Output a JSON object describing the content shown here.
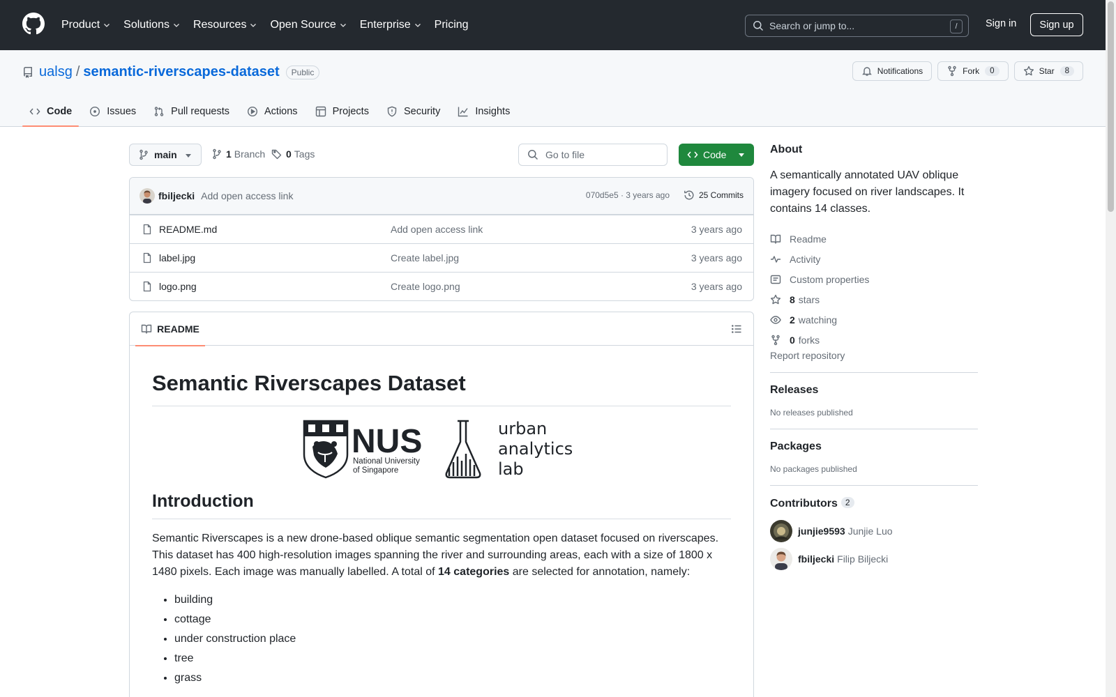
{
  "header": {
    "nav": [
      {
        "label": "Product",
        "caret": true
      },
      {
        "label": "Solutions",
        "caret": true
      },
      {
        "label": "Resources",
        "caret": true
      },
      {
        "label": "Open Source",
        "caret": true
      },
      {
        "label": "Enterprise",
        "caret": true
      },
      {
        "label": "Pricing",
        "caret": false
      }
    ],
    "search_placeholder": "Search or jump to...",
    "search_key": "/",
    "signin": "Sign in",
    "signup": "Sign up"
  },
  "repo": {
    "owner": "ualsg",
    "separator": "/",
    "name": "semantic-riverscapes-dataset",
    "visibility": "Public",
    "notifications": "Notifications",
    "fork_label": "Fork",
    "fork_count": "0",
    "star_label": "Star",
    "star_count": "8",
    "tabs": [
      {
        "label": "Code",
        "icon": "code-icon",
        "selected": true
      },
      {
        "label": "Issues",
        "icon": "issue-icon",
        "selected": false
      },
      {
        "label": "Pull requests",
        "icon": "pull-request-icon",
        "selected": false
      },
      {
        "label": "Actions",
        "icon": "play-icon",
        "selected": false
      },
      {
        "label": "Projects",
        "icon": "table-icon",
        "selected": false
      },
      {
        "label": "Security",
        "icon": "shield-icon",
        "selected": false
      },
      {
        "label": "Insights",
        "icon": "graph-icon",
        "selected": false
      }
    ]
  },
  "code": {
    "branch": "main",
    "branch_count": "1",
    "branch_label": "Branch",
    "tag_count": "0",
    "tag_label": "Tags",
    "goto_placeholder": "Go to file",
    "code_button": "Code",
    "commit": {
      "author": "fbiljecki",
      "message": "Add open access link",
      "meta": "070d5e5 · 3 years ago",
      "count_label": "25 Commits"
    },
    "files": [
      {
        "name": "README.md",
        "message": "Add open access link",
        "age": "3 years ago"
      },
      {
        "name": "label.jpg",
        "message": "Create label.jpg",
        "age": "3 years ago"
      },
      {
        "name": "logo.png",
        "message": "Create logo.png",
        "age": "3 years ago"
      }
    ]
  },
  "readme": {
    "tab": "README",
    "title": "Semantic Riverscapes Dataset",
    "logo_nus": {
      "big": "NUS",
      "line1": "National University",
      "line2": "of Singapore"
    },
    "logo_ual": {
      "line1": "urban",
      "line2": "analytics",
      "line3": "lab"
    },
    "intro_heading": "Introduction",
    "intro_before": "Semantic Riverscapes is a new drone-based oblique semantic segmentation open dataset focused on riverscapes. This dataset has 400 high-resolution images spanning the river and surrounding areas, each with a size of 1800 x 1480 pixels. Each image was manually labelled. A total of ",
    "intro_bold": "14 categories",
    "intro_after": " are selected for annotation, namely:",
    "categories": [
      "building",
      "cottage",
      "under construction place",
      "tree",
      "grass"
    ]
  },
  "about": {
    "heading": "About",
    "description": "A semantically annotated UAV oblique imagery focused on river landscapes. It contains 14 classes.",
    "links": [
      {
        "icon": "book-icon",
        "count": "",
        "label": "Readme"
      },
      {
        "icon": "pulse-icon",
        "count": "",
        "label": "Activity"
      },
      {
        "icon": "note-icon",
        "count": "",
        "label": "Custom properties"
      },
      {
        "icon": "star-icon",
        "count": "8",
        "label": "stars"
      },
      {
        "icon": "eye-icon",
        "count": "2",
        "label": "watching"
      },
      {
        "icon": "fork-icon",
        "count": "0",
        "label": "forks"
      }
    ],
    "report": "Report repository"
  },
  "releases": {
    "heading": "Releases",
    "empty": "No releases published"
  },
  "packages": {
    "heading": "Packages",
    "empty": "No packages published"
  },
  "contributors": {
    "heading": "Contributors",
    "count": "2",
    "list": [
      {
        "login": "junjie9593",
        "name": "Junjie Luo"
      },
      {
        "login": "fbiljecki",
        "name": "Filip Biljecki"
      }
    ]
  },
  "colors": {
    "accent": "#0969da",
    "primary_button": "#1f883d",
    "header_bg": "#24292f",
    "tab_underline": "#fd8c73"
  }
}
